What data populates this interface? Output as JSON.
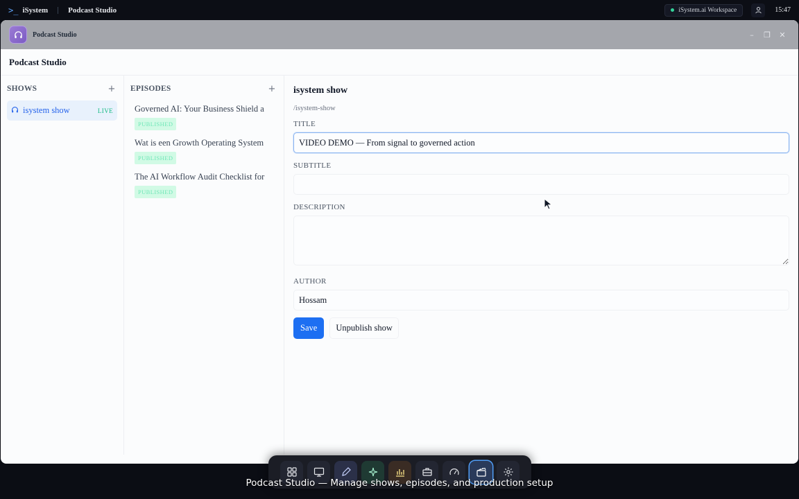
{
  "system_bar": {
    "brand": "iSystem",
    "active_app": "Podcast Studio",
    "workspace": "iSystem.ai Workspace",
    "clock": "15:47"
  },
  "window": {
    "title": "Podcast Studio",
    "header": "Podcast Studio"
  },
  "shows": {
    "heading": "SHOWS",
    "items": [
      {
        "name": "isystem show",
        "status": "LIVE",
        "icon": "headphones-icon"
      }
    ]
  },
  "episodes": {
    "heading": "EPISODES",
    "items": [
      {
        "title": "Governed AI: Your Business Shield a",
        "status": "PUBLISHED"
      },
      {
        "title": "Wat is een Growth Operating System",
        "status": "PUBLISHED"
      },
      {
        "title": "The AI Workflow Audit Checklist for",
        "status": "PUBLISHED"
      }
    ]
  },
  "editor": {
    "show_name": "isystem show",
    "slug": "/isystem-show",
    "title_label": "TITLE",
    "title_value": "VIDEO DEMO — From signal to governed action",
    "subtitle_label": "SUBTITLE",
    "subtitle_value": "",
    "description_label": "DESCRIPTION",
    "description_value": "",
    "author_label": "AUTHOR",
    "author_value": "Hossam",
    "save_label": "Save",
    "unpublish_label": "Unpublish show"
  },
  "dock": {
    "items": [
      "apps-grid-icon",
      "monitor-icon",
      "pen-icon",
      "sparkles-icon",
      "chart-icon",
      "briefcase-icon",
      "gauge-icon",
      "clapperboard-icon",
      "settings-gear-icon"
    ],
    "active": "clapperboard-icon"
  },
  "caption": "Podcast Studio — Manage shows, episodes, and production setup",
  "colors": {
    "accent": "#1d6ff2",
    "live": "#10b981",
    "published_bg": "#d1fae5",
    "titlebar": "#a4a6ac"
  }
}
